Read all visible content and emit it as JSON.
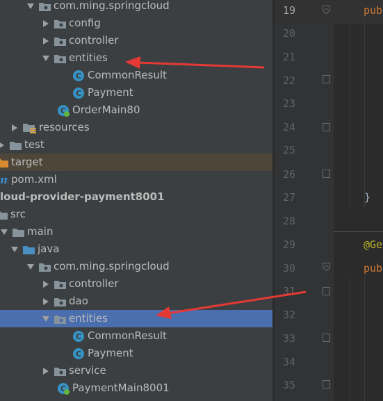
{
  "tree": {
    "rows": [
      {
        "label": "com.ming.springcloud",
        "arrow": "down",
        "icon": "package"
      },
      {
        "label": "config",
        "arrow": "right",
        "icon": "package"
      },
      {
        "label": "controller",
        "arrow": "right",
        "icon": "package"
      },
      {
        "label": "entities",
        "arrow": "down",
        "icon": "package"
      },
      {
        "label": "CommonResult",
        "arrow": "none",
        "icon": "class"
      },
      {
        "label": "Payment",
        "arrow": "none",
        "icon": "class"
      },
      {
        "label": "OrderMain80",
        "arrow": "none",
        "icon": "springboot-class"
      },
      {
        "label": "resources",
        "arrow": "right",
        "icon": "resources-folder"
      },
      {
        "label": "test",
        "arrow": "right",
        "icon": "folder"
      },
      {
        "label": "target",
        "arrow": "none",
        "icon": "orange-folder"
      },
      {
        "label": "pom.xml",
        "arrow": "none",
        "icon": "maven"
      },
      {
        "label": "loud-provider-payment8001",
        "arrow": "none",
        "icon": "none"
      },
      {
        "label": "src",
        "arrow": "none",
        "icon": "folder"
      },
      {
        "label": "main",
        "arrow": "down",
        "icon": "folder"
      },
      {
        "label": "java",
        "arrow": "down",
        "icon": "source-folder"
      },
      {
        "label": "com.ming.springcloud",
        "arrow": "down",
        "icon": "package"
      },
      {
        "label": "controller",
        "arrow": "right",
        "icon": "package"
      },
      {
        "label": "dao",
        "arrow": "right",
        "icon": "package"
      },
      {
        "label": "entities",
        "arrow": "down",
        "icon": "package"
      },
      {
        "label": "CommonResult",
        "arrow": "none",
        "icon": "class"
      },
      {
        "label": "Payment",
        "arrow": "none",
        "icon": "class"
      },
      {
        "label": "service",
        "arrow": "right",
        "icon": "package"
      },
      {
        "label": "PaymentMain8001",
        "arrow": "none",
        "icon": "springboot-class"
      }
    ]
  },
  "gutter": {
    "line_numbers": [
      "19",
      "20",
      "21",
      "22",
      "23",
      "24",
      "25",
      "26",
      "27",
      "28",
      "29",
      "30",
      "31",
      "32",
      "33",
      "34",
      "35"
    ]
  },
  "editor": {
    "lines": [
      {
        "line": "19",
        "text": "pub",
        "cls": "kw"
      },
      {
        "line": "27",
        "text": "}",
        "cls": "txt"
      },
      {
        "line": "29",
        "text": "@Ge",
        "cls": "ann"
      },
      {
        "line": "30",
        "text": "pub",
        "cls": "kw"
      }
    ]
  },
  "colors": {
    "accent_selection": "#4b6eaf",
    "annotation_arrow": "#e53935",
    "package_folder": "#87939a",
    "class_icon": "#3592c4"
  }
}
